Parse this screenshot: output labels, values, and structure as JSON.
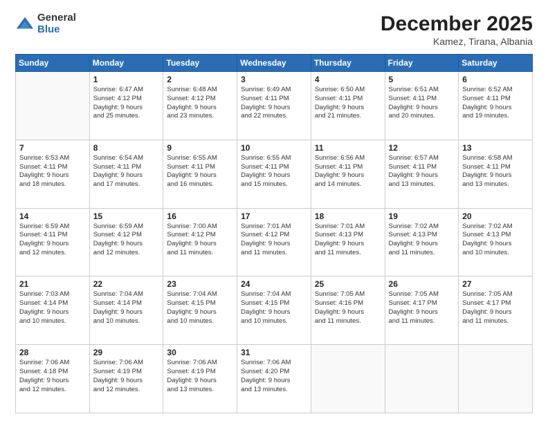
{
  "logo": {
    "general": "General",
    "blue": "Blue"
  },
  "header": {
    "month": "December 2025",
    "location": "Kamez, Tirana, Albania"
  },
  "weekdays": [
    "Sunday",
    "Monday",
    "Tuesday",
    "Wednesday",
    "Thursday",
    "Friday",
    "Saturday"
  ],
  "weeks": [
    [
      {
        "day": "",
        "info": ""
      },
      {
        "day": "1",
        "info": "Sunrise: 6:47 AM\nSunset: 4:12 PM\nDaylight: 9 hours\nand 25 minutes."
      },
      {
        "day": "2",
        "info": "Sunrise: 6:48 AM\nSunset: 4:12 PM\nDaylight: 9 hours\nand 23 minutes."
      },
      {
        "day": "3",
        "info": "Sunrise: 6:49 AM\nSunset: 4:11 PM\nDaylight: 9 hours\nand 22 minutes."
      },
      {
        "day": "4",
        "info": "Sunrise: 6:50 AM\nSunset: 4:11 PM\nDaylight: 9 hours\nand 21 minutes."
      },
      {
        "day": "5",
        "info": "Sunrise: 6:51 AM\nSunset: 4:11 PM\nDaylight: 9 hours\nand 20 minutes."
      },
      {
        "day": "6",
        "info": "Sunrise: 6:52 AM\nSunset: 4:11 PM\nDaylight: 9 hours\nand 19 minutes."
      }
    ],
    [
      {
        "day": "7",
        "info": "Sunrise: 6:53 AM\nSunset: 4:11 PM\nDaylight: 9 hours\nand 18 minutes."
      },
      {
        "day": "8",
        "info": "Sunrise: 6:54 AM\nSunset: 4:11 PM\nDaylight: 9 hours\nand 17 minutes."
      },
      {
        "day": "9",
        "info": "Sunrise: 6:55 AM\nSunset: 4:11 PM\nDaylight: 9 hours\nand 16 minutes."
      },
      {
        "day": "10",
        "info": "Sunrise: 6:55 AM\nSunset: 4:11 PM\nDaylight: 9 hours\nand 15 minutes."
      },
      {
        "day": "11",
        "info": "Sunrise: 6:56 AM\nSunset: 4:11 PM\nDaylight: 9 hours\nand 14 minutes."
      },
      {
        "day": "12",
        "info": "Sunrise: 6:57 AM\nSunset: 4:11 PM\nDaylight: 9 hours\nand 13 minutes."
      },
      {
        "day": "13",
        "info": "Sunrise: 6:58 AM\nSunset: 4:11 PM\nDaylight: 9 hours\nand 13 minutes."
      }
    ],
    [
      {
        "day": "14",
        "info": "Sunrise: 6:59 AM\nSunset: 4:11 PM\nDaylight: 9 hours\nand 12 minutes."
      },
      {
        "day": "15",
        "info": "Sunrise: 6:59 AM\nSunset: 4:12 PM\nDaylight: 9 hours\nand 12 minutes."
      },
      {
        "day": "16",
        "info": "Sunrise: 7:00 AM\nSunset: 4:12 PM\nDaylight: 9 hours\nand 11 minutes."
      },
      {
        "day": "17",
        "info": "Sunrise: 7:01 AM\nSunset: 4:12 PM\nDaylight: 9 hours\nand 11 minutes."
      },
      {
        "day": "18",
        "info": "Sunrise: 7:01 AM\nSunset: 4:13 PM\nDaylight: 9 hours\nand 11 minutes."
      },
      {
        "day": "19",
        "info": "Sunrise: 7:02 AM\nSunset: 4:13 PM\nDaylight: 9 hours\nand 11 minutes."
      },
      {
        "day": "20",
        "info": "Sunrise: 7:02 AM\nSunset: 4:13 PM\nDaylight: 9 hours\nand 10 minutes."
      }
    ],
    [
      {
        "day": "21",
        "info": "Sunrise: 7:03 AM\nSunset: 4:14 PM\nDaylight: 9 hours\nand 10 minutes."
      },
      {
        "day": "22",
        "info": "Sunrise: 7:04 AM\nSunset: 4:14 PM\nDaylight: 9 hours\nand 10 minutes."
      },
      {
        "day": "23",
        "info": "Sunrise: 7:04 AM\nSunset: 4:15 PM\nDaylight: 9 hours\nand 10 minutes."
      },
      {
        "day": "24",
        "info": "Sunrise: 7:04 AM\nSunset: 4:15 PM\nDaylight: 9 hours\nand 10 minutes."
      },
      {
        "day": "25",
        "info": "Sunrise: 7:05 AM\nSunset: 4:16 PM\nDaylight: 9 hours\nand 11 minutes."
      },
      {
        "day": "26",
        "info": "Sunrise: 7:05 AM\nSunset: 4:17 PM\nDaylight: 9 hours\nand 11 minutes."
      },
      {
        "day": "27",
        "info": "Sunrise: 7:05 AM\nSunset: 4:17 PM\nDaylight: 9 hours\nand 11 minutes."
      }
    ],
    [
      {
        "day": "28",
        "info": "Sunrise: 7:06 AM\nSunset: 4:18 PM\nDaylight: 9 hours\nand 12 minutes."
      },
      {
        "day": "29",
        "info": "Sunrise: 7:06 AM\nSunset: 4:19 PM\nDaylight: 9 hours\nand 12 minutes."
      },
      {
        "day": "30",
        "info": "Sunrise: 7:06 AM\nSunset: 4:19 PM\nDaylight: 9 hours\nand 13 minutes."
      },
      {
        "day": "31",
        "info": "Sunrise: 7:06 AM\nSunset: 4:20 PM\nDaylight: 9 hours\nand 13 minutes."
      },
      {
        "day": "",
        "info": ""
      },
      {
        "day": "",
        "info": ""
      },
      {
        "day": "",
        "info": ""
      }
    ]
  ]
}
